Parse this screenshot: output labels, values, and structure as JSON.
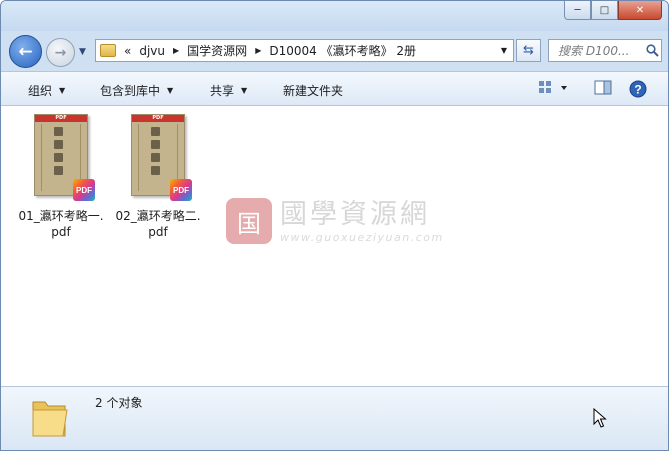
{
  "window": {
    "controls": {
      "minimize": "─",
      "maximize": "□",
      "close": "✕"
    }
  },
  "nav": {
    "back_icon": "back-arrow-icon",
    "forward_icon": "forward-arrow-icon",
    "breadcrumb": [
      {
        "label": "«"
      },
      {
        "label": "djvu"
      },
      {
        "label": "国学资源网"
      },
      {
        "label": "D10004 《瀛环考略》 2册"
      }
    ],
    "search_placeholder": "搜索 D100..."
  },
  "toolbar": {
    "organize": "组织",
    "include_in_library": "包含到库中",
    "share": "共享",
    "new_folder": "新建文件夹"
  },
  "files": [
    {
      "name": "01_瀛环考略一.pdf",
      "badge": "PDF",
      "band": "PDF",
      "type": "pdf"
    },
    {
      "name": "02_瀛环考略二.pdf",
      "badge": "PDF",
      "band": "PDF",
      "type": "pdf"
    }
  ],
  "watermark": {
    "seal": "国",
    "title": "國學資源網",
    "url": "www.guoxueziyuan.com"
  },
  "status": {
    "item_count": "2 个对象"
  },
  "colors": {
    "accent": "#2862c0",
    "close": "#c74a2f",
    "seal": "#d2686a"
  }
}
